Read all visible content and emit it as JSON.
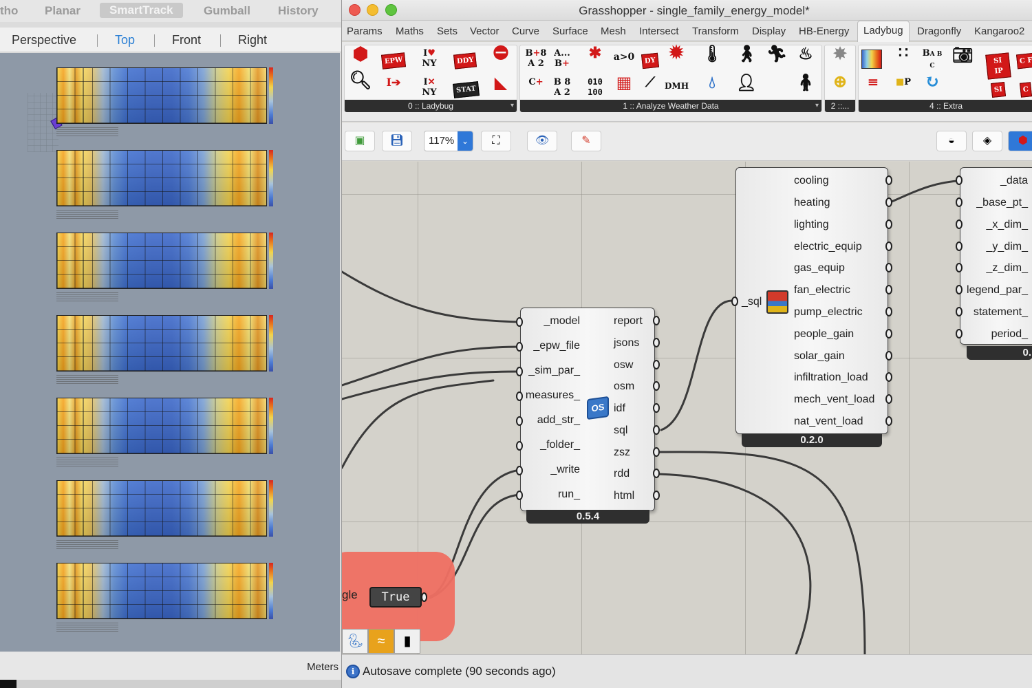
{
  "rhino": {
    "osnap": [
      "tho",
      "Planar",
      "SmartTrack",
      "Gumball",
      "History"
    ],
    "viewport_tabs": [
      "Perspective",
      "Top",
      "Front",
      "Right"
    ],
    "active_viewport": "Top",
    "units": "Meters",
    "heatmap_count": 7
  },
  "gh": {
    "title": "Grasshopper - single_family_energy_model*",
    "menu": [
      "Params",
      "Maths",
      "Sets",
      "Vector",
      "Curve",
      "Surface",
      "Mesh",
      "Intersect",
      "Transform",
      "Display",
      "HB-Energy",
      "Ladybug",
      "Dragonfly",
      "Kangaroo2"
    ],
    "active_menu": "Ladybug",
    "ribbon_groups": [
      "0 :: Ladybug",
      "1 :: Analyze Weather Data",
      "2 ::...",
      "4 :: Extra"
    ],
    "ribbon_icons": {
      "epw": "EPW",
      "ddy": "DDY",
      "stat": "STAT",
      "dmh": "DMH",
      "ny": "NY",
      "bits": "010 100",
      "dy": "DY",
      "si_ip": "SI IP",
      "agt0": "a>0"
    },
    "zoom": "117%",
    "components": {
      "sim": {
        "inputs": [
          "_model",
          "_epw_file",
          "_sim_par_",
          "measures_",
          "add_str_",
          "_folder_",
          "_write",
          "run_"
        ],
        "outputs": [
          "report",
          "jsons",
          "osw",
          "osm",
          "idf",
          "sql",
          "zsz",
          "rdd",
          "html"
        ],
        "version": "0.5.4"
      },
      "results": {
        "inputs": [
          "_sql"
        ],
        "outputs": [
          "cooling",
          "heating",
          "lighting",
          "electric_equip",
          "gas_equip",
          "fan_electric",
          "pump_electric",
          "people_gain",
          "solar_gain",
          "infiltration_load",
          "mech_vent_load",
          "nat_vent_load"
        ],
        "version": "0.2.0"
      },
      "chart": {
        "inputs": [
          "_data",
          "_base_pt_",
          "_x_dim_",
          "_y_dim_",
          "_z_dim_",
          "legend_par_",
          "statement_",
          "period_"
        ],
        "version": "0."
      }
    },
    "toggle": {
      "label": "gle",
      "value": "True"
    },
    "status": "Autosave complete (90 seconds ago)"
  }
}
